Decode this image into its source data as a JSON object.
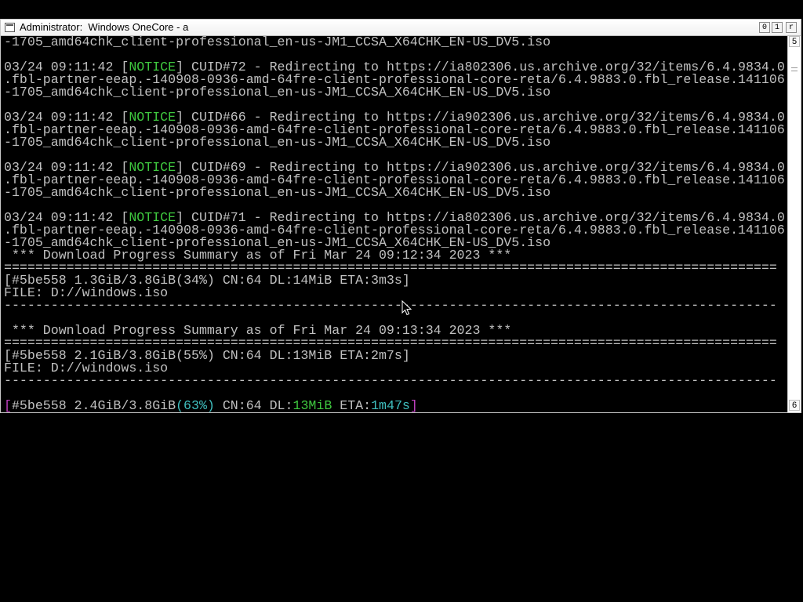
{
  "window": {
    "title": "Administrator:  Windows OneCore - a",
    "controls": {
      "minimize": "0",
      "maximize": "1",
      "close": "r"
    }
  },
  "scrollbar": {
    "up_label": "5",
    "down_label": "6"
  },
  "console": {
    "line00": "-1705_amd64chk_client-professional_en-us-JM1_CCSA_X64CHK_EN-US_DV5.iso",
    "line01": "",
    "line02a": "03/24 09:11:42 [",
    "line02b": "NOTICE",
    "line02c": "] CUID#72 - Redirecting to https://ia802306.us.archive.org/32/items/6.4.9834.0",
    "line03": ".fbl-partner-eeap.-140908-0936-amd-64fre-client-professional-core-reta/6.4.9883.0.fbl_release.141106",
    "line04": "-1705_amd64chk_client-professional_en-us-JM1_CCSA_X64CHK_EN-US_DV5.iso",
    "line05": "",
    "line06a": "03/24 09:11:42 [",
    "line06b": "NOTICE",
    "line06c": "] CUID#66 - Redirecting to https://ia902306.us.archive.org/32/items/6.4.9834.0",
    "line07": ".fbl-partner-eeap.-140908-0936-amd-64fre-client-professional-core-reta/6.4.9883.0.fbl_release.141106",
    "line08": "-1705_amd64chk_client-professional_en-us-JM1_CCSA_X64CHK_EN-US_DV5.iso",
    "line09": "",
    "line10a": "03/24 09:11:42 [",
    "line10b": "NOTICE",
    "line10c": "] CUID#69 - Redirecting to https://ia902306.us.archive.org/32/items/6.4.9834.0",
    "line11": ".fbl-partner-eeap.-140908-0936-amd-64fre-client-professional-core-reta/6.4.9883.0.fbl_release.141106",
    "line12": "-1705_amd64chk_client-professional_en-us-JM1_CCSA_X64CHK_EN-US_DV5.iso",
    "line13": "",
    "line14a": "03/24 09:11:42 [",
    "line14b": "NOTICE",
    "line14c": "] CUID#71 - Redirecting to https://ia802306.us.archive.org/32/items/6.4.9834.0",
    "line15": ".fbl-partner-eeap.-140908-0936-amd-64fre-client-professional-core-reta/6.4.9883.0.fbl_release.141106",
    "line16": "-1705_amd64chk_client-professional_en-us-JM1_CCSA_X64CHK_EN-US_DV5.iso",
    "line17": " *** Download Progress Summary as of Fri Mar 24 09:12:34 2023 ***",
    "line18": "===================================================================================================",
    "line19": "[#5be558 1.3GiB/3.8GiB(34%) CN:64 DL:14MiB ETA:3m3s]",
    "line20": "FILE: D://windows.iso",
    "line21": "---------------------------------------------------------------------------------------------------",
    "line22": "",
    "line23": " *** Download Progress Summary as of Fri Mar 24 09:13:34 2023 ***",
    "line24": "===================================================================================================",
    "line25": "[#5be558 2.1GiB/3.8GiB(55%) CN:64 DL:13MiB ETA:2m7s]",
    "line26": "FILE: D://windows.iso",
    "line27": "---------------------------------------------------------------------------------------------------",
    "line28": "",
    "status": {
      "open_bracket": "[",
      "gid_size": "#5be558 2.4GiB/3.8GiB",
      "percent": "(63%)",
      "cn": " CN:64 DL:",
      "speed": "13MiB",
      "eta_label": " ETA:",
      "eta": "1m47s",
      "close_bracket": "]"
    }
  }
}
